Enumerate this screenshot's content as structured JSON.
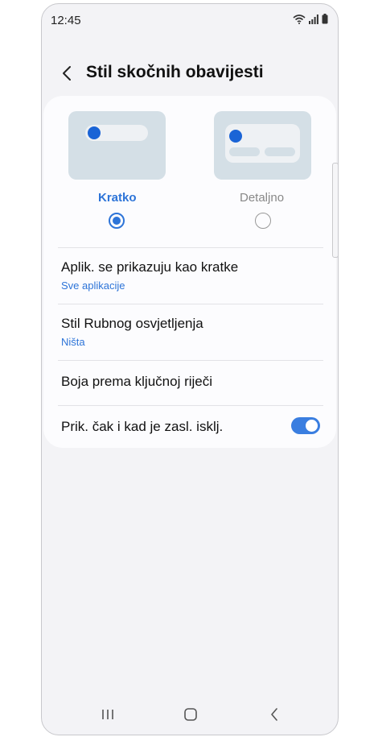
{
  "status": {
    "time": "12:45"
  },
  "header": {
    "title": "Stil skočnih obavijesti"
  },
  "styles": {
    "brief_label": "Kratko",
    "detailed_label": "Detaljno",
    "selected": "brief"
  },
  "settings": {
    "apps_title": "Aplik. se prikazuju kao kratke",
    "apps_sub": "Sve aplikacije",
    "edge_title": "Stil Rubnog osvjetljenja",
    "edge_sub": "Ništa",
    "keyword_title": "Boja prema ključnoj riječi",
    "screen_off_title": "Prik. čak i kad je zasl. isklj.",
    "screen_off_on": true
  },
  "colors": {
    "accent": "#2d74d8",
    "preview": "#d4dfe6",
    "background": "#f3f3f6"
  },
  "icons": [
    "wifi-icon",
    "signal-icon",
    "battery-icon",
    "back-arrow-icon",
    "recents-icon",
    "home-icon",
    "nav-back-icon"
  ]
}
